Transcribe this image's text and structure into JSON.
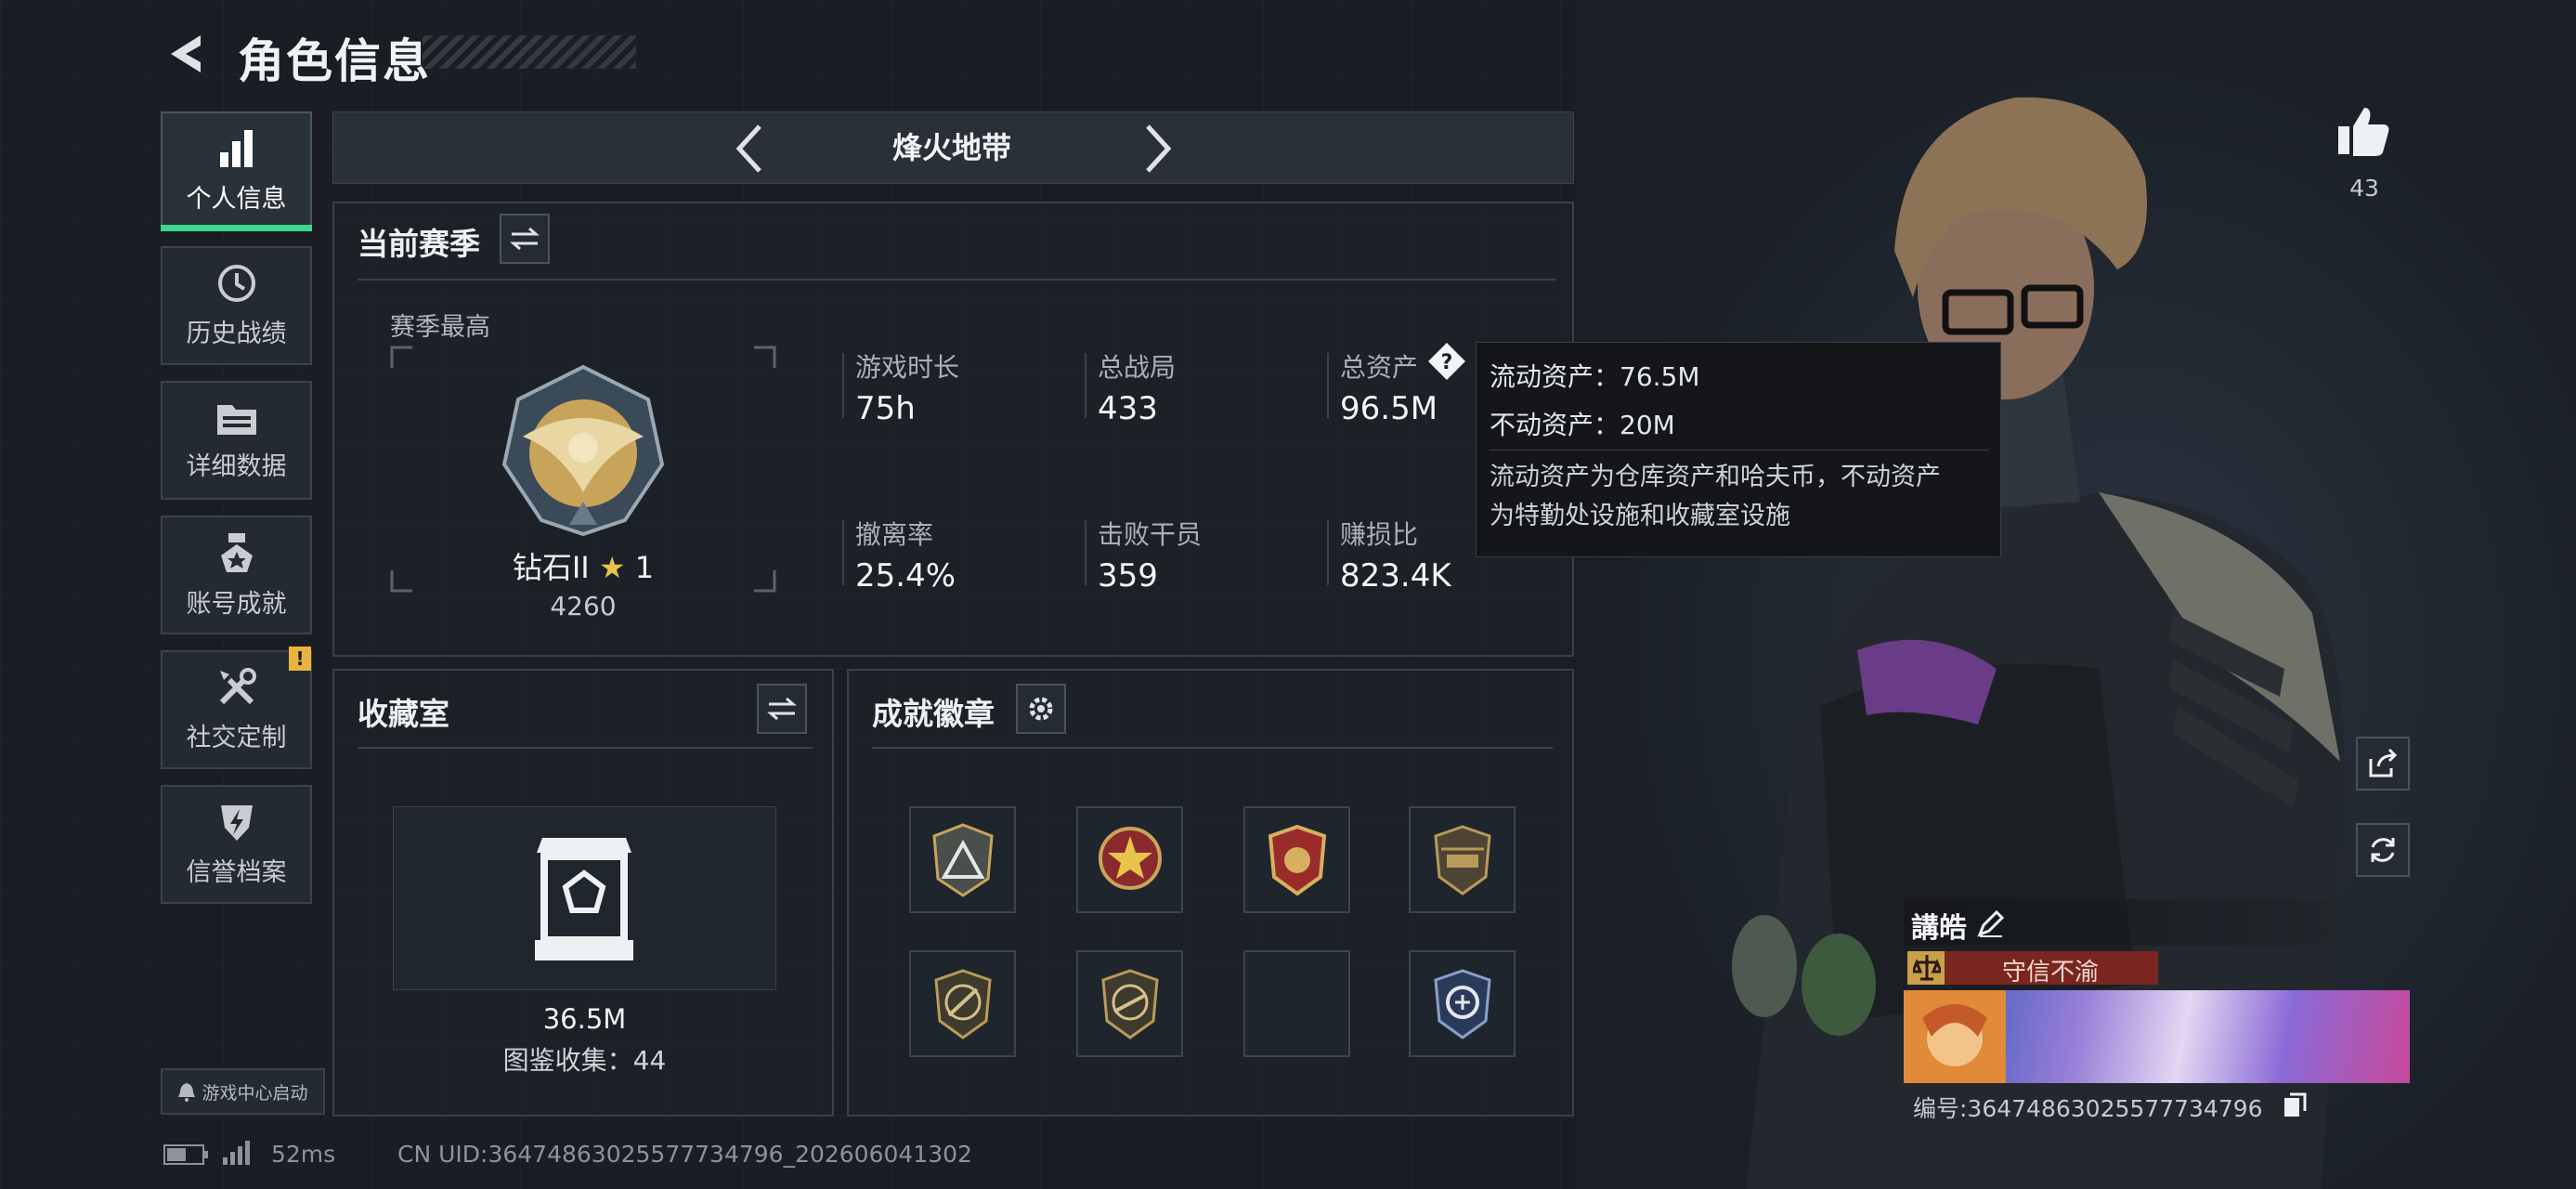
{
  "header": {
    "title": "角色信息"
  },
  "sidebar": {
    "items": [
      {
        "label": "个人信息",
        "icon": "bar-chart-icon"
      },
      {
        "label": "历史战绩",
        "icon": "history-icon"
      },
      {
        "label": "详细数据",
        "icon": "folder-icon"
      },
      {
        "label": "账号成就",
        "icon": "medal-icon"
      },
      {
        "label": "社交定制",
        "icon": "tools-icon"
      },
      {
        "label": "信誉档案",
        "icon": "shield-bolt-icon"
      }
    ],
    "warning_badge": "!",
    "game_center": "游戏中心启动"
  },
  "mode": {
    "title": "烽火地带"
  },
  "season": {
    "title": "当前赛季",
    "best_label": "赛季最高",
    "rank_name": "钻石II",
    "rank_stars": "1",
    "rank_score": "4260",
    "stats": [
      {
        "label": "游戏时长",
        "value": "75h"
      },
      {
        "label": "总战局",
        "value": "433"
      },
      {
        "label": "总资产",
        "value": "96.5M"
      },
      {
        "label": "撤离率",
        "value": "25.4%"
      },
      {
        "label": "击败干员",
        "value": "359"
      },
      {
        "label": "赚损比",
        "value": "823.4K"
      }
    ]
  },
  "tooltip": {
    "liquid": "流动资产：76.5M",
    "fixed": "不动资产：20M",
    "desc_line1": "流动资产为仓库资产和哈夫币，不动资产",
    "desc_line2": "为特勤处设施和收藏室设施"
  },
  "collection": {
    "title": "收藏室",
    "value": "36.5M",
    "count": "图鉴收集：44"
  },
  "badges": {
    "title": "成就徽章"
  },
  "character": {
    "likes": "43",
    "name": "講皓",
    "honor": "守信不渝",
    "id": "编号:3647486302557773479­6"
  },
  "footer": {
    "ping": "52ms",
    "uid": "CN UID:3647486302557773479­6_202606041302"
  },
  "colors": {
    "accent": "#3ed88a",
    "warning": "#e8b53a",
    "honor_bg": "#8a2a22"
  }
}
